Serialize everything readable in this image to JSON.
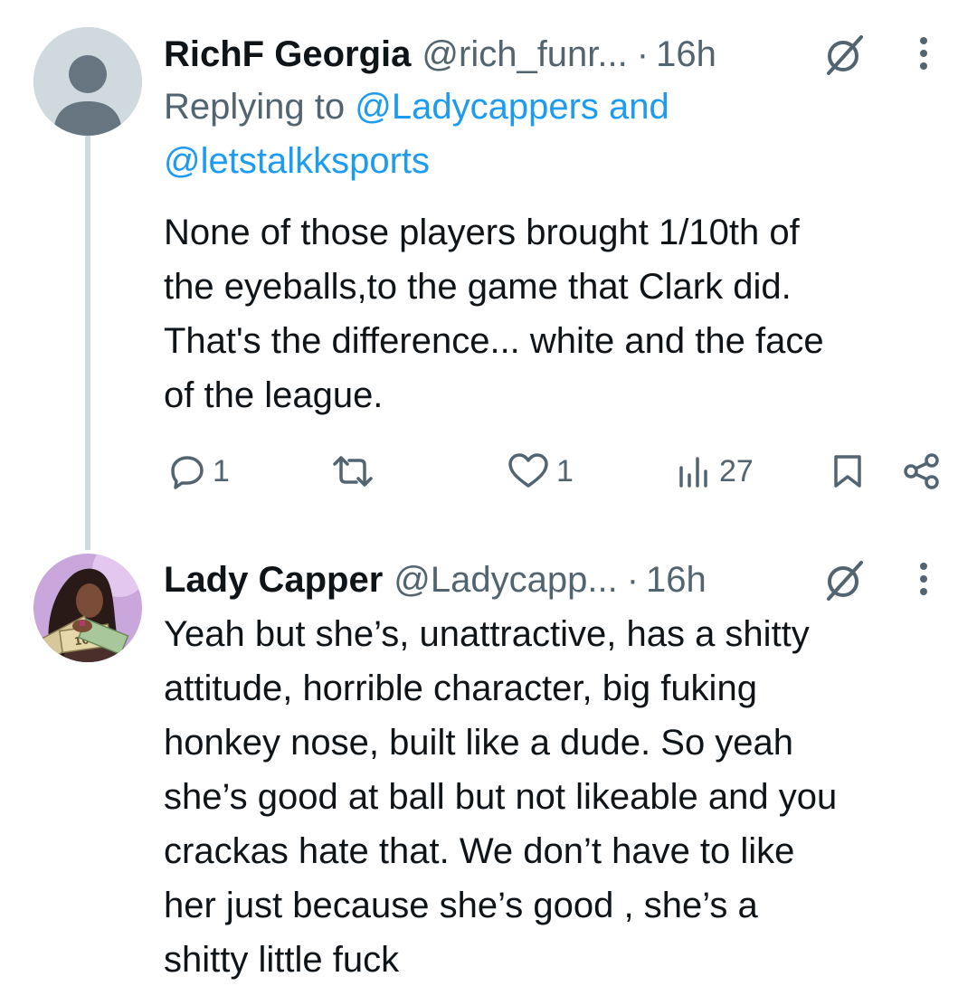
{
  "tweets": [
    {
      "name": "RichF Georgia",
      "handle": "@rich_funr...",
      "dot": "·",
      "time": "16h",
      "replying_prefix": "Replying to",
      "reply_mention_1": "@Ladycappers",
      "reply_and": "and",
      "reply_mention_2": "@letstalkksports",
      "lines": [
        "None of those players brought 1/10th of",
        "the eyeballs,to the game that Clark did.",
        "That's the difference... white and the face",
        "of the league."
      ],
      "stats": {
        "replies": "1",
        "likes": "1",
        "views": "27"
      }
    },
    {
      "name": "Lady Capper",
      "handle": "@Ladycapp...",
      "dot": "·",
      "time": "16h",
      "lines": [
        "Yeah but she’s, unattractive, has a shitty",
        "attitude, horrible character, big fuking",
        "honkey nose, built like a dude. So yeah",
        "she’s good at ball but not likeable and you",
        "crackas hate that. We don’t have to like",
        "her just because she’s good , she’s a",
        "shitty little fuck"
      ],
      "avatar_banknote_text": "100"
    }
  ],
  "icons": {
    "reply": "reply-icon",
    "retweet": "retweet-icon",
    "like": "heart-icon",
    "views": "views-icon",
    "bookmark": "bookmark-icon",
    "share": "share-icon",
    "grok": "grok-icon",
    "more": "more-icon"
  },
  "colors": {
    "text_primary": "#0f1419",
    "text_secondary": "#536471",
    "link": "#1d9bf0",
    "thread_line": "#cfd9de"
  }
}
